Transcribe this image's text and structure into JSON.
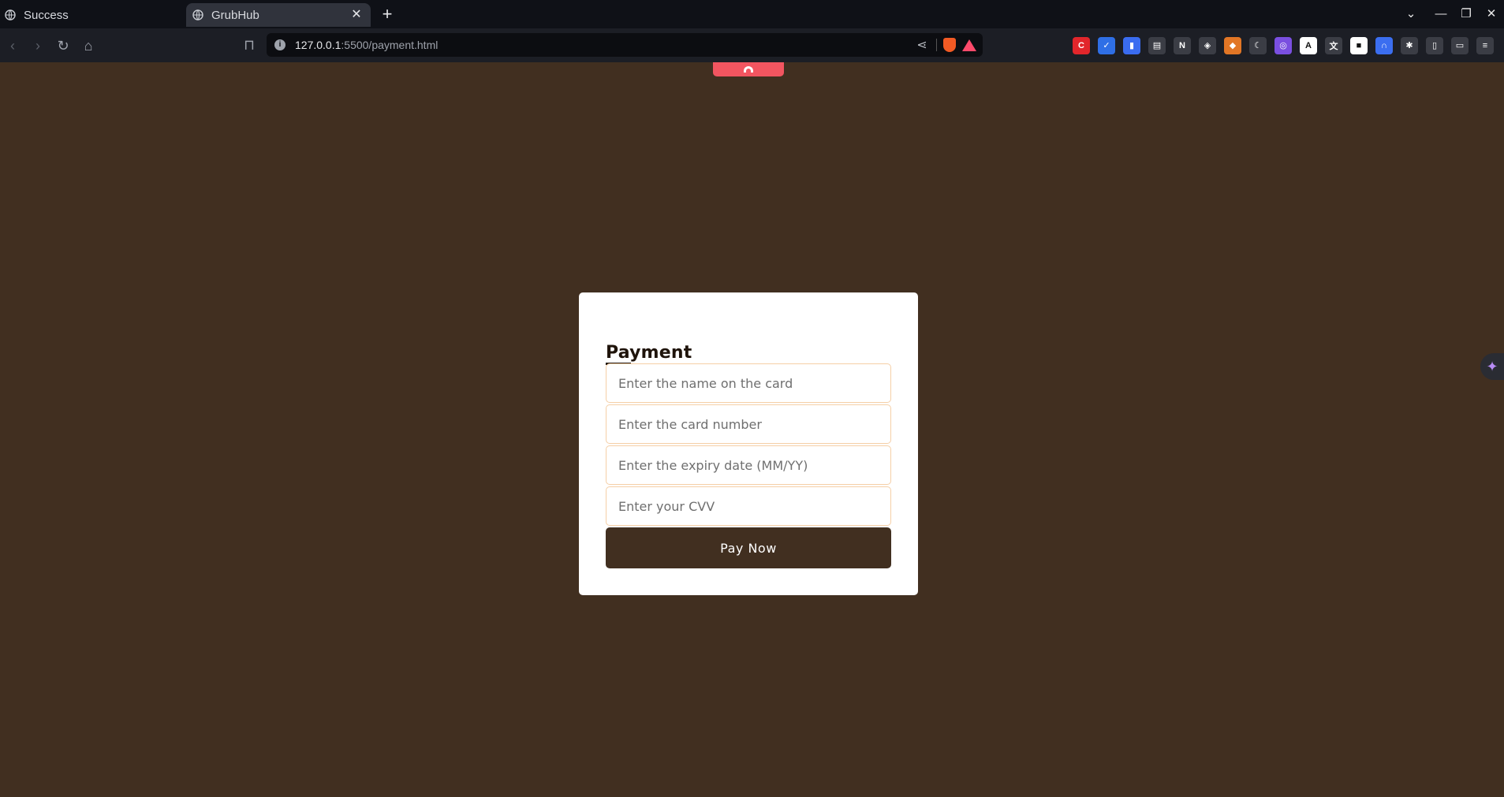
{
  "browser": {
    "tabs": [
      {
        "title": "Success",
        "active": false
      },
      {
        "title": "GrubHub",
        "active": true
      }
    ],
    "url_host": "127.0.0.1",
    "url_path": ":5500/payment.html",
    "icons": {
      "back": "arrow-left-icon",
      "forward": "arrow-right-icon",
      "reload": "reload-icon",
      "home": "home-icon",
      "bookmark": "bookmark-icon",
      "share": "share-icon"
    }
  },
  "extensions": [
    {
      "name": "ext-red-c",
      "glyph": "C",
      "color": "#e2262b"
    },
    {
      "name": "ext-blue-check",
      "glyph": "✓",
      "color": "#2f6fe6"
    },
    {
      "name": "ext-blue-bookmark",
      "glyph": "▮",
      "color": "#3a6cf0"
    },
    {
      "name": "ext-notebook",
      "glyph": "▤",
      "color": "#3b3d45"
    },
    {
      "name": "ext-notion",
      "glyph": "N",
      "color": "#3b3d45"
    },
    {
      "name": "ext-cube",
      "glyph": "◈",
      "color": "#3b3d45"
    },
    {
      "name": "ext-metamask",
      "glyph": "◆",
      "color": "#e27625"
    },
    {
      "name": "ext-moon",
      "glyph": "☾",
      "color": "#3b3d45"
    },
    {
      "name": "ext-color-ring",
      "glyph": "◎",
      "color": "#7a4fe0"
    },
    {
      "name": "ext-a-circle",
      "glyph": "A",
      "color": "#ffffff"
    },
    {
      "name": "ext-text",
      "glyph": "文",
      "color": "#3b3d45"
    },
    {
      "name": "ext-square",
      "glyph": "■",
      "color": "#ffffff"
    },
    {
      "name": "ext-arch",
      "glyph": "∩",
      "color": "#3b6ef0"
    },
    {
      "name": "ext-puzzle",
      "glyph": "✱",
      "color": "#3b3d45"
    },
    {
      "name": "ext-sidebar",
      "glyph": "▯",
      "color": "#3b3d45"
    },
    {
      "name": "ext-wallet",
      "glyph": "▭",
      "color": "#3b3d45"
    },
    {
      "name": "ext-menu",
      "glyph": "≡",
      "color": "#3b3d45"
    }
  ],
  "payment": {
    "title": "Payment",
    "name_placeholder": "Enter the name on the card",
    "card_placeholder": "Enter the card number",
    "expiry_placeholder": "Enter the expiry date (MM/YY)",
    "cvv_placeholder": "Enter your CVV",
    "pay_label": "Pay Now"
  },
  "colors": {
    "page_bg": "#412f20",
    "button_bg": "#412f20",
    "field_border": "#f5cfa6",
    "card_bg": "#ffffff"
  }
}
